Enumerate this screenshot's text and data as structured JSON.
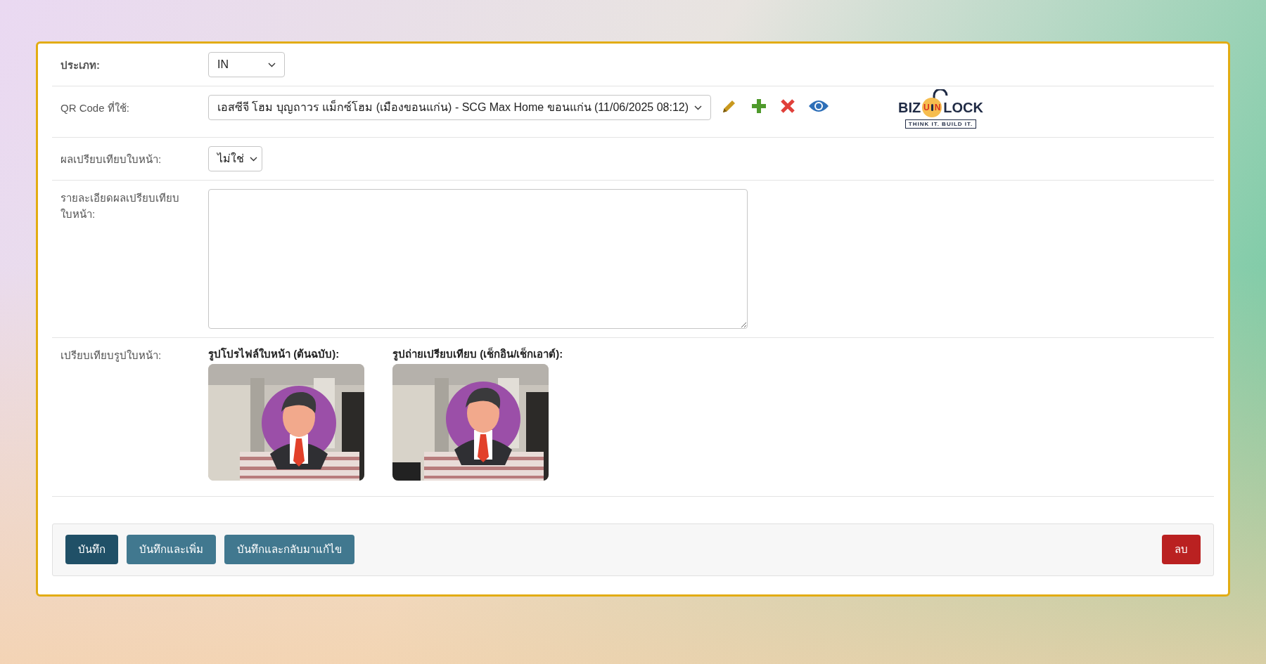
{
  "form": {
    "rows": [
      {
        "kind": "select",
        "label": "ประเภท:",
        "value": "IN"
      },
      {
        "kind": "qr",
        "label": "QR Code ที่ใช้:",
        "value": "เอสซีจี โฮม บุญถาวร แม็กซ์โฮม (เมืองขอนแก่น) - SCG Max Home ขอนแก่น (11/06/2025 08:12)",
        "logo": {
          "left": "BIZ",
          "mid_1": "U",
          "mid_2": "N",
          "right": "LOCK",
          "tagline": "THINK IT. BUILD IT."
        }
      },
      {
        "kind": "select",
        "label": "ผลเปรียบเทียบใบหน้า:",
        "value": "ไม่ใช่"
      },
      {
        "kind": "textarea",
        "label": "รายละเอียดผลเปรียบเทียบใบหน้า:"
      },
      {
        "kind": "photos",
        "label": "เปรียบเทียบรูปใบหน้า:",
        "photos": [
          {
            "caption": "รูปโปรไฟล์ใบหน้า (ต้นฉบับ):",
            "kind": "picture"
          },
          {
            "caption": "รูปถ่ายเปรียบเทียบ (เช็กอิน/เช็กเอาต์):",
            "kind": "picture"
          }
        ]
      }
    ]
  },
  "actions": [
    {
      "label": "บันทึก",
      "kind": "primary"
    },
    {
      "label": "บันทึกและเพิ่ม",
      "kind": "secondary"
    },
    {
      "label": "บันทึกและกลับมาแก้ไข",
      "kind": "secondary"
    },
    {
      "label": "ลบ",
      "kind": "danger"
    }
  ]
}
